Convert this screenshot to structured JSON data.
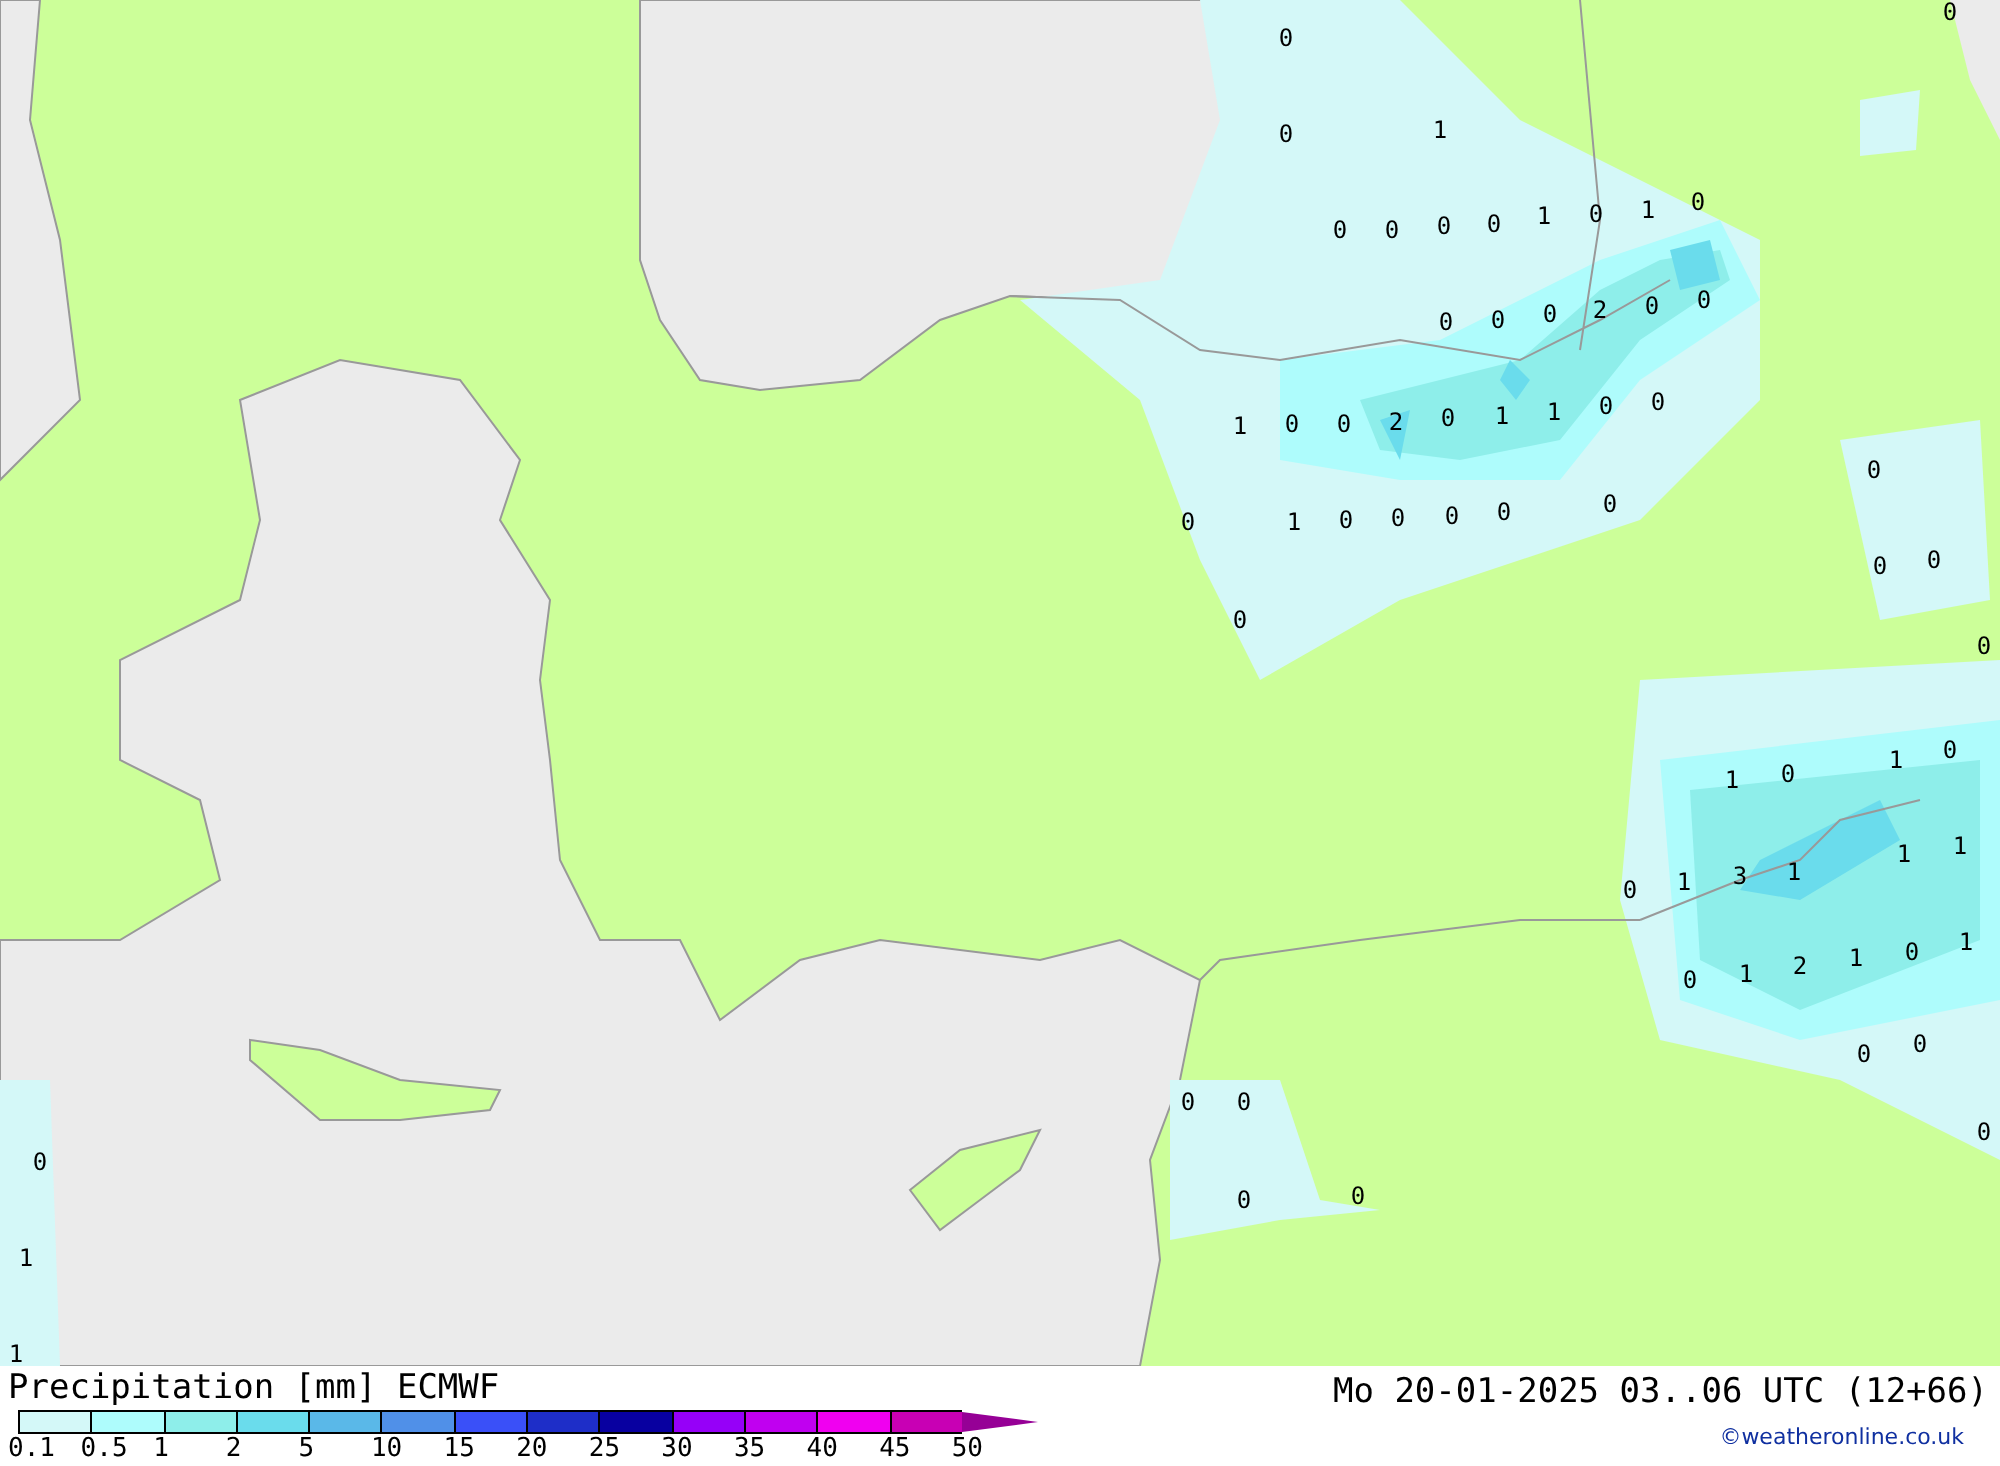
{
  "map": {
    "value_labels": [
      "0",
      "0",
      "0",
      "1",
      "0",
      "0",
      "0",
      "0",
      "1",
      "0",
      "1",
      "0",
      "0",
      "0",
      "0",
      "2",
      "0",
      "0",
      "1",
      "0",
      "0",
      "2",
      "0",
      "1",
      "1",
      "0",
      "0",
      "0",
      "1",
      "0",
      "0",
      "0",
      "0",
      "0",
      "0",
      "0",
      "0",
      "0",
      "0",
      "1",
      "0",
      "1",
      "0",
      "0",
      "1",
      "3",
      "1",
      "1",
      "1",
      "0",
      "1",
      "2",
      "1",
      "0",
      "1",
      "0",
      "0",
      "0",
      "0",
      "0",
      "0",
      "0",
      "0",
      "1",
      "1"
    ]
  },
  "legend": {
    "title": "Precipitation [mm] ECMWF",
    "bins": [
      {
        "kind": "box",
        "color": "#d4f8f8"
      },
      {
        "kind": "box",
        "color": "#aefcfc"
      },
      {
        "kind": "box",
        "color": "#8eeeea"
      },
      {
        "kind": "box",
        "color": "#6adcec"
      },
      {
        "kind": "box",
        "color": "#5ab8e8"
      },
      {
        "kind": "box",
        "color": "#5090e8"
      },
      {
        "kind": "box",
        "color": "#3a50f8"
      },
      {
        "kind": "box",
        "color": "#1e2ec8"
      },
      {
        "kind": "box",
        "color": "#0800a0"
      },
      {
        "kind": "box",
        "color": "#9600f8"
      },
      {
        "kind": "box",
        "color": "#c000f0"
      },
      {
        "kind": "box",
        "color": "#f000f0"
      },
      {
        "kind": "box",
        "color": "#c800b4"
      },
      {
        "kind": "arrow",
        "color": "#960096"
      }
    ],
    "ticks": [
      "0.1",
      "0.5",
      "1",
      "2",
      "5",
      "10",
      "15",
      "20",
      "25",
      "30",
      "35",
      "40",
      "45",
      "50"
    ],
    "valid_time": "Mo 20-01-2025 03..06 UTC (12+66)",
    "credit": "©weatheronline.co.uk"
  }
}
